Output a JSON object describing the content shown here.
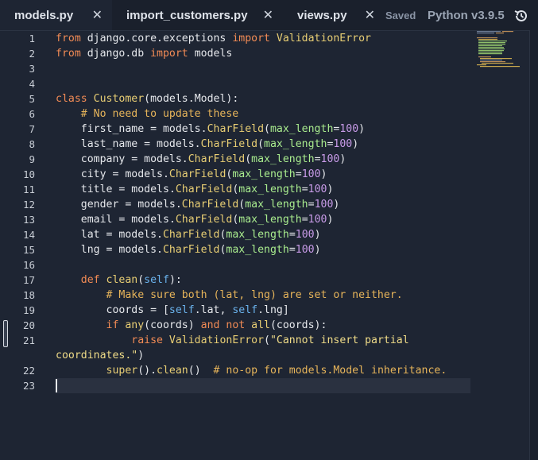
{
  "tabs": [
    {
      "label": "models.py",
      "active": true,
      "close": "✕"
    },
    {
      "label": "import_customers.py",
      "active": false,
      "close": "✕"
    },
    {
      "label": "views.py",
      "active": false,
      "close": "✕"
    }
  ],
  "status": {
    "saved": "Saved",
    "language": "Python v3.9.5",
    "icon": "history-icon"
  },
  "colors": {
    "background": "#1e2533",
    "keyword": "#f28b55",
    "function": "#e8ce74",
    "comment": "#e6b45a",
    "param": "#a9ec8e",
    "number": "#c89be8",
    "self": "#6ab2ec",
    "string": "#f0dc88"
  },
  "lines": [
    {
      "n": "1",
      "tokens": [
        [
          "kw",
          "from"
        ],
        [
          "tx",
          " django.core.exceptions "
        ],
        [
          "kw",
          "import"
        ],
        [
          "fn",
          " ValidationError"
        ]
      ]
    },
    {
      "n": "2",
      "tokens": [
        [
          "kw",
          "from"
        ],
        [
          "tx",
          " django.db "
        ],
        [
          "kw",
          "import"
        ],
        [
          "tx",
          " models"
        ]
      ]
    },
    {
      "n": "3",
      "tokens": []
    },
    {
      "n": "4",
      "tokens": []
    },
    {
      "n": "5",
      "tokens": [
        [
          "kw",
          "class"
        ],
        [
          "fn",
          " Customer"
        ],
        [
          "tx",
          "(models.Model):"
        ]
      ]
    },
    {
      "n": "6",
      "tokens": [
        [
          "cm",
          "    # No need to update these"
        ]
      ]
    },
    {
      "n": "7",
      "tokens": [
        [
          "tx",
          "    first_name = models."
        ],
        [
          "fn",
          "CharField"
        ],
        [
          "tx",
          "("
        ],
        [
          "pa",
          "max_length"
        ],
        [
          "tx",
          "="
        ],
        [
          "nu",
          "100"
        ],
        [
          "tx",
          ")"
        ]
      ]
    },
    {
      "n": "8",
      "tokens": [
        [
          "tx",
          "    last_name = models."
        ],
        [
          "fn",
          "CharField"
        ],
        [
          "tx",
          "("
        ],
        [
          "pa",
          "max_length"
        ],
        [
          "tx",
          "="
        ],
        [
          "nu",
          "100"
        ],
        [
          "tx",
          ")"
        ]
      ]
    },
    {
      "n": "9",
      "tokens": [
        [
          "tx",
          "    company = models."
        ],
        [
          "fn",
          "CharField"
        ],
        [
          "tx",
          "("
        ],
        [
          "pa",
          "max_length"
        ],
        [
          "tx",
          "="
        ],
        [
          "nu",
          "100"
        ],
        [
          "tx",
          ")"
        ]
      ]
    },
    {
      "n": "10",
      "tokens": [
        [
          "tx",
          "    city = models."
        ],
        [
          "fn",
          "CharField"
        ],
        [
          "tx",
          "("
        ],
        [
          "pa",
          "max_length"
        ],
        [
          "tx",
          "="
        ],
        [
          "nu",
          "100"
        ],
        [
          "tx",
          ")"
        ]
      ]
    },
    {
      "n": "11",
      "tokens": [
        [
          "tx",
          "    title = models."
        ],
        [
          "fn",
          "CharField"
        ],
        [
          "tx",
          "("
        ],
        [
          "pa",
          "max_length"
        ],
        [
          "tx",
          "="
        ],
        [
          "nu",
          "100"
        ],
        [
          "tx",
          ")"
        ]
      ]
    },
    {
      "n": "12",
      "tokens": [
        [
          "tx",
          "    gender = models."
        ],
        [
          "fn",
          "CharField"
        ],
        [
          "tx",
          "("
        ],
        [
          "pa",
          "max_length"
        ],
        [
          "tx",
          "="
        ],
        [
          "nu",
          "100"
        ],
        [
          "tx",
          ")"
        ]
      ]
    },
    {
      "n": "13",
      "tokens": [
        [
          "tx",
          "    email = models."
        ],
        [
          "fn",
          "CharField"
        ],
        [
          "tx",
          "("
        ],
        [
          "pa",
          "max_length"
        ],
        [
          "tx",
          "="
        ],
        [
          "nu",
          "100"
        ],
        [
          "tx",
          ")"
        ]
      ]
    },
    {
      "n": "14",
      "tokens": [
        [
          "tx",
          "    lat = models."
        ],
        [
          "fn",
          "CharField"
        ],
        [
          "tx",
          "("
        ],
        [
          "pa",
          "max_length"
        ],
        [
          "tx",
          "="
        ],
        [
          "nu",
          "100"
        ],
        [
          "tx",
          ")"
        ]
      ]
    },
    {
      "n": "15",
      "tokens": [
        [
          "tx",
          "    lng = models."
        ],
        [
          "fn",
          "CharField"
        ],
        [
          "tx",
          "("
        ],
        [
          "pa",
          "max_length"
        ],
        [
          "tx",
          "="
        ],
        [
          "nu",
          "100"
        ],
        [
          "tx",
          ")"
        ]
      ]
    },
    {
      "n": "16",
      "tokens": []
    },
    {
      "n": "17",
      "tokens": [
        [
          "kw",
          "    def"
        ],
        [
          "fn",
          " clean"
        ],
        [
          "tx",
          "("
        ],
        [
          "se",
          "self"
        ],
        [
          "tx",
          "):"
        ]
      ]
    },
    {
      "n": "18",
      "tokens": [
        [
          "cm",
          "        # Make sure both (lat, lng) are set or neither."
        ]
      ]
    },
    {
      "n": "19",
      "tokens": [
        [
          "tx",
          "        coords = ["
        ],
        [
          "se",
          "self"
        ],
        [
          "tx",
          ".lat, "
        ],
        [
          "se",
          "self"
        ],
        [
          "tx",
          ".lng]"
        ]
      ]
    },
    {
      "n": "20",
      "tokens": [
        [
          "kw",
          "        if"
        ],
        [
          "fn",
          " any"
        ],
        [
          "tx",
          "(coords) "
        ],
        [
          "kw",
          "and not"
        ],
        [
          "fn",
          " all"
        ],
        [
          "tx",
          "(coords):"
        ]
      ]
    },
    {
      "n": "21",
      "tokens": [
        [
          "kw",
          "            raise"
        ],
        [
          "fn",
          " ValidationError"
        ],
        [
          "tx",
          "("
        ],
        [
          "st",
          "\"Cannot insert partial"
        ]
      ]
    },
    {
      "n": "",
      "tokens": [
        [
          "st",
          "coordinates.\""
        ],
        [
          "tx",
          ")"
        ]
      ]
    },
    {
      "n": "22",
      "tokens": [
        [
          "fn",
          "        super"
        ],
        [
          "tx",
          "()."
        ],
        [
          "fn",
          "clean"
        ],
        [
          "tx",
          "()  "
        ],
        [
          "cm",
          "# no-op for models.Model inheritance."
        ]
      ]
    },
    {
      "n": "23",
      "tokens": []
    }
  ]
}
